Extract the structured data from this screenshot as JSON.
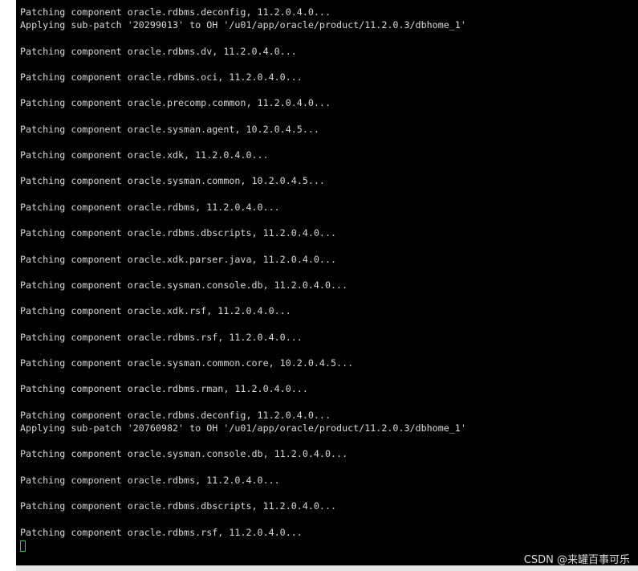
{
  "terminal": {
    "lines": [
      "Patching component oracle.rdbms.deconfig, 11.2.0.4.0...",
      "Applying sub-patch '20299013' to OH '/u01/app/oracle/product/11.2.0.3/dbhome_1'",
      "",
      "Patching component oracle.rdbms.dv, 11.2.0.4.0...",
      "",
      "Patching component oracle.rdbms.oci, 11.2.0.4.0...",
      "",
      "Patching component oracle.precomp.common, 11.2.0.4.0...",
      "",
      "Patching component oracle.sysman.agent, 10.2.0.4.5...",
      "",
      "Patching component oracle.xdk, 11.2.0.4.0...",
      "",
      "Patching component oracle.sysman.common, 10.2.0.4.5...",
      "",
      "Patching component oracle.rdbms, 11.2.0.4.0...",
      "",
      "Patching component oracle.rdbms.dbscripts, 11.2.0.4.0...",
      "",
      "Patching component oracle.xdk.parser.java, 11.2.0.4.0...",
      "",
      "Patching component oracle.sysman.console.db, 11.2.0.4.0...",
      "",
      "Patching component oracle.xdk.rsf, 11.2.0.4.0...",
      "",
      "Patching component oracle.rdbms.rsf, 11.2.0.4.0...",
      "",
      "Patching component oracle.sysman.common.core, 10.2.0.4.5...",
      "",
      "Patching component oracle.rdbms.rman, 11.2.0.4.0...",
      "",
      "Patching component oracle.rdbms.deconfig, 11.2.0.4.0...",
      "Applying sub-patch '20760982' to OH '/u01/app/oracle/product/11.2.0.3/dbhome_1'",
      "",
      "Patching component oracle.sysman.console.db, 11.2.0.4.0...",
      "",
      "Patching component oracle.rdbms, 11.2.0.4.0...",
      "",
      "Patching component oracle.rdbms.dbscripts, 11.2.0.4.0...",
      "",
      "Patching component oracle.rdbms.rsf, 11.2.0.4.0..."
    ],
    "cursor_color": "#2ecc40",
    "background_color": "#000000",
    "text_color": "#d9d9d9"
  },
  "watermark": {
    "text": "CSDN @来罐百事可乐"
  }
}
